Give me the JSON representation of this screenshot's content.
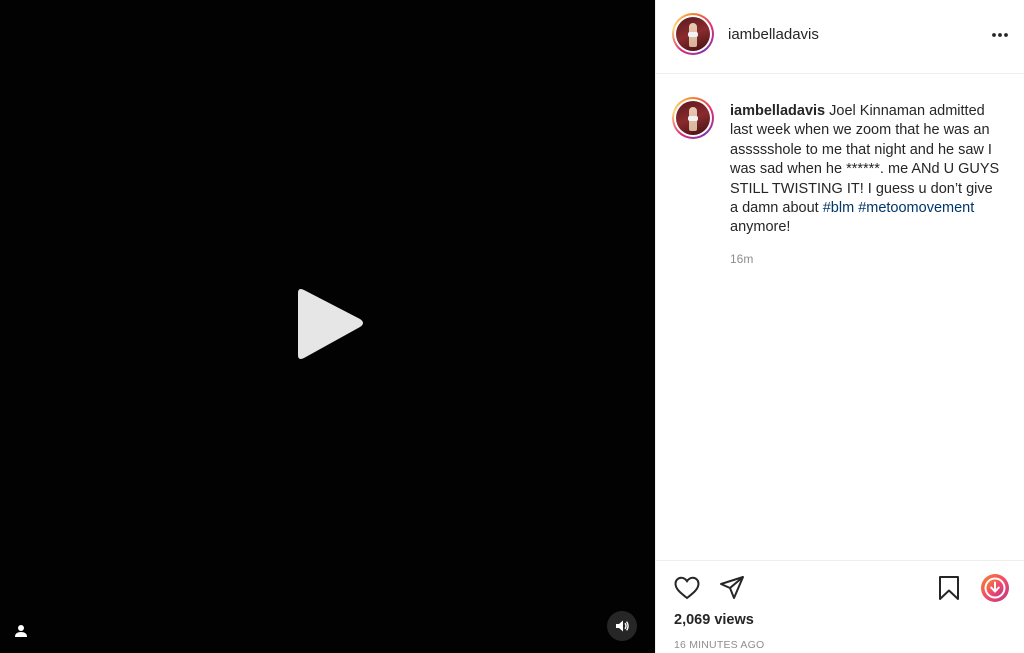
{
  "post": {
    "username": "iambelladavis",
    "caption": {
      "username": "iambelladavis",
      "text_1": " Joel Kinnaman admitted last week when we zoom that he was an assssshole to me that night and he saw I was sad when he ******. me ANd U GUYS STILL TWISTING IT! I guess u don’t give a damn about ",
      "hashtag_1": "#blm",
      "text_2": " ",
      "hashtag_2": "#metoomovement",
      "text_3": " anymore!"
    },
    "comment_time": "16m",
    "views": "2,069 views",
    "posted_ago": "16 MINUTES AGO"
  },
  "icons": {
    "play": "play-icon",
    "tag": "person-icon",
    "sound": "speaker-icon",
    "more": "more-icon",
    "like": "heart-icon",
    "share": "paper-plane-icon",
    "save": "bookmark-icon",
    "download": "download-icon"
  },
  "colors": {
    "video_bg": "#020202",
    "text": "#262626",
    "muted": "#8e8e8e",
    "hashtag": "#00376b",
    "ring_start": "#f58529",
    "ring_end": "#dd2a7b"
  }
}
